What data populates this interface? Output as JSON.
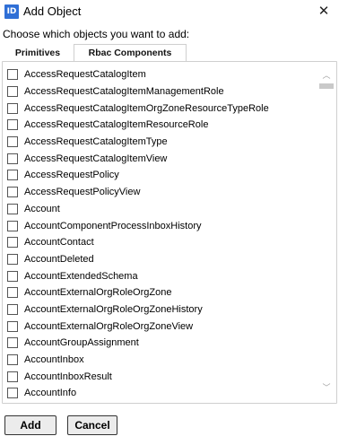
{
  "window": {
    "app_icon": "ID",
    "title": "Add Object",
    "close_glyph": "✕"
  },
  "prompt": "Choose which objects you want to add:",
  "tabs": {
    "primitives": "Primitives",
    "rbac": "Rbac Components",
    "active": "Rbac Components"
  },
  "items": [
    {
      "label": "AccessRequestCatalogItem",
      "checked": false
    },
    {
      "label": "AccessRequestCatalogItemManagementRole",
      "checked": false
    },
    {
      "label": "AccessRequestCatalogItemOrgZoneResourceTypeRole",
      "checked": false
    },
    {
      "label": "AccessRequestCatalogItemResourceRole",
      "checked": false
    },
    {
      "label": "AccessRequestCatalogItemType",
      "checked": false
    },
    {
      "label": "AccessRequestCatalogItemView",
      "checked": false
    },
    {
      "label": "AccessRequestPolicy",
      "checked": false
    },
    {
      "label": "AccessRequestPolicyView",
      "checked": false
    },
    {
      "label": "Account",
      "checked": false
    },
    {
      "label": "AccountComponentProcessInboxHistory",
      "checked": false
    },
    {
      "label": "AccountContact",
      "checked": false
    },
    {
      "label": "AccountDeleted",
      "checked": false
    },
    {
      "label": "AccountExtendedSchema",
      "checked": false
    },
    {
      "label": "AccountExternalOrgRoleOrgZone",
      "checked": false
    },
    {
      "label": "AccountExternalOrgRoleOrgZoneHistory",
      "checked": false
    },
    {
      "label": "AccountExternalOrgRoleOrgZoneView",
      "checked": false
    },
    {
      "label": "AccountGroupAssignment",
      "checked": false
    },
    {
      "label": "AccountInbox",
      "checked": false
    },
    {
      "label": "AccountInboxResult",
      "checked": false
    },
    {
      "label": "AccountInfo",
      "checked": false
    }
  ],
  "scroll": {
    "up_glyph": "︿",
    "down_glyph": "﹀"
  },
  "buttons": {
    "add": "Add",
    "cancel": "Cancel"
  }
}
